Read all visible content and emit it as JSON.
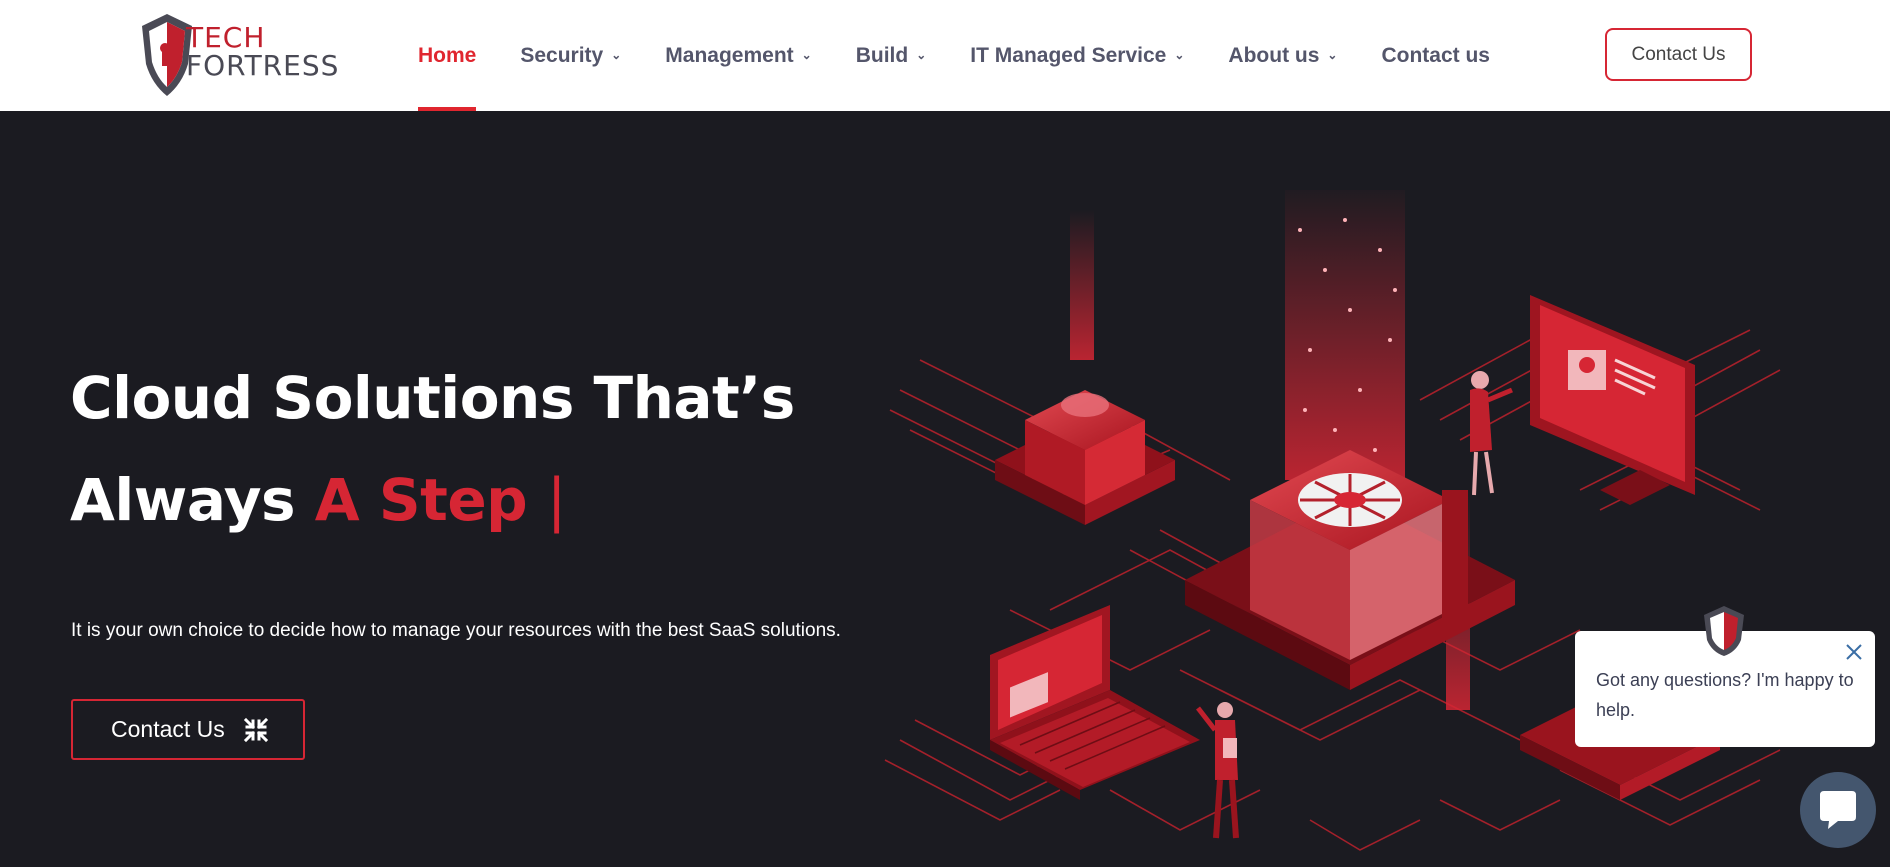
{
  "header": {
    "logo": {
      "line1": "TECH",
      "line2": "FORTRESS"
    },
    "nav": [
      {
        "label": "Home",
        "active": true,
        "dropdown": false
      },
      {
        "label": "Security",
        "dropdown": true
      },
      {
        "label": "Management",
        "dropdown": true
      },
      {
        "label": "Build",
        "dropdown": true
      },
      {
        "label": "IT Managed Service",
        "dropdown": true
      },
      {
        "label": "About us",
        "dropdown": true
      },
      {
        "label": "Contact us",
        "dropdown": false
      }
    ],
    "cta_label": "Contact Us"
  },
  "hero": {
    "title_line1": "Cloud Solutions That’s",
    "title_line2_white": "Always",
    "title_line2_red": "A Step",
    "typing_cursor": "|",
    "subtitle": "It is your own choice to decide how to manage your resources with the best SaaS solutions.",
    "button_label": "Contact Us"
  },
  "chat": {
    "message": "Got any questions? I'm happy to help."
  },
  "colors": {
    "accent": "#d62634",
    "nav_active": "#e0262f",
    "nav_text": "#54566b",
    "hero_bg": "#1b1b21",
    "chat_launcher": "#44566e"
  }
}
